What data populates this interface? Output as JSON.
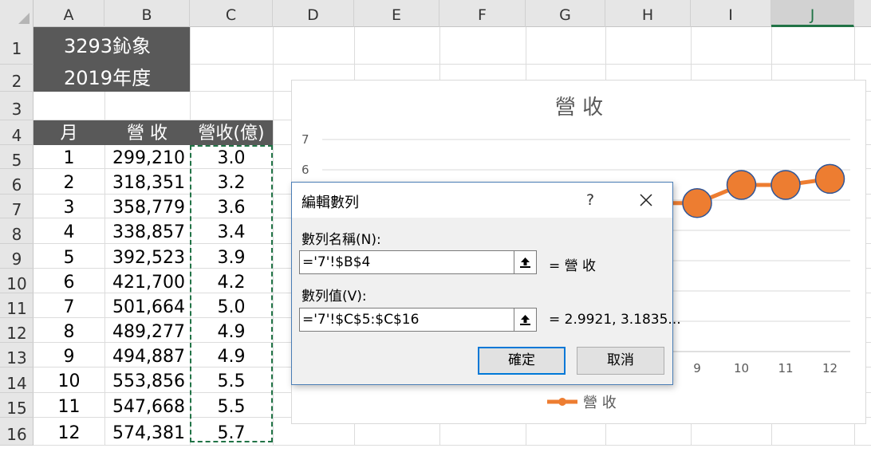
{
  "columns": [
    "A",
    "B",
    "C",
    "D",
    "E",
    "F",
    "G",
    "H",
    "I",
    "J"
  ],
  "selected_column": "J",
  "rows": [
    "1",
    "2",
    "3",
    "4",
    "5",
    "6",
    "7",
    "8",
    "9",
    "10",
    "11",
    "12",
    "13",
    "14",
    "15",
    "16"
  ],
  "title_block": {
    "line1": "3293鈊象",
    "line2": "2019年度"
  },
  "table": {
    "headers": [
      "月",
      "營 收",
      "營收(億)"
    ],
    "rows": [
      [
        "1",
        "299,210",
        "3.0"
      ],
      [
        "2",
        "318,351",
        "3.2"
      ],
      [
        "3",
        "358,779",
        "3.6"
      ],
      [
        "4",
        "338,857",
        "3.4"
      ],
      [
        "5",
        "392,523",
        "3.9"
      ],
      [
        "6",
        "421,700",
        "4.2"
      ],
      [
        "7",
        "501,664",
        "5.0"
      ],
      [
        "8",
        "489,277",
        "4.9"
      ],
      [
        "9",
        "494,887",
        "4.9"
      ],
      [
        "10",
        "553,856",
        "5.5"
      ],
      [
        "11",
        "547,668",
        "5.5"
      ],
      [
        "12",
        "574,381",
        "5.7"
      ]
    ]
  },
  "chart_data": {
    "type": "line",
    "title": "營 收",
    "series": [
      {
        "name": "營 收",
        "values": [
          3.0,
          3.2,
          3.6,
          3.4,
          3.9,
          4.2,
          5.0,
          4.9,
          4.9,
          5.5,
          5.5,
          5.7
        ]
      }
    ],
    "categories": [
      "1",
      "2",
      "3",
      "4",
      "5",
      "6",
      "7",
      "8",
      "9",
      "10",
      "11",
      "12"
    ],
    "y_ticks": [
      "6",
      "7"
    ],
    "x_ticks": [
      "9",
      "10",
      "11",
      "12"
    ],
    "ylim": [
      0,
      7
    ],
    "legend": "bottom",
    "color": "#ED7D31",
    "grid": true
  },
  "dialog": {
    "title": "編輯數列",
    "help": "?",
    "name_label": "數列名稱(N):",
    "name_value": "='7'!$B$4",
    "name_result": "= 營 收",
    "values_label": "數列值(V):",
    "values_value": "='7'!$C$5:$C$16",
    "values_result": "= 2.9921, 3.1835...",
    "ok": "確定",
    "cancel": "取消"
  },
  "colors": {
    "header_fill": "#595959",
    "accent": "#217346",
    "series": "#ED7D31",
    "dialog_border": "#4a7db5"
  }
}
